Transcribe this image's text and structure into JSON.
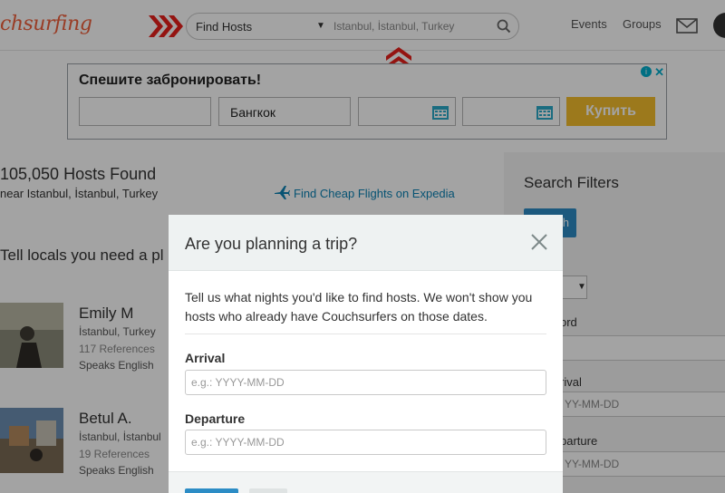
{
  "header": {
    "logo_text": "chsurfing",
    "search_type": "Find Hosts",
    "search_location": "Istanbul, İstanbul, Turkey",
    "nav_events": "Events",
    "nav_groups": "Groups"
  },
  "ad": {
    "title": "Спешите забронировать!",
    "destination": "Бангкок",
    "buy_label": "Купить",
    "info_glyph": "i",
    "close_glyph": "✕"
  },
  "results": {
    "hosts_found": "105,050 Hosts Found",
    "near_text": "near Istanbul, İstanbul, Turkey",
    "flights_link": "Find Cheap Flights on Expedia",
    "tell_locals": "Tell locals you need a pl"
  },
  "hosts": [
    {
      "name": "Emily M",
      "location": "İstanbul, Turkey",
      "references": "117 References",
      "languages": "Speaks English"
    },
    {
      "name": "Betul A.",
      "location": "İstanbul, İstanbul",
      "references": "19 References",
      "languages": "Speaks English"
    }
  ],
  "filters": {
    "title": "Search Filters",
    "button_label": "h",
    "keyword_label": "ord",
    "arrival_label": "rival",
    "arrival_placeholder": "YY-MM-DD",
    "departure_label": "parture",
    "departure_placeholder": "YY-MM-DD"
  },
  "modal": {
    "title": "Are you planning a trip?",
    "description": "Tell us what nights you'd like to find hosts. We won't show you hosts who already have Couchsurfers on those dates.",
    "arrival_label": "Arrival",
    "arrival_placeholder": "e.g.: YYYY-MM-DD",
    "departure_label": "Departure",
    "departure_placeholder": "e.g.: YYYY-MM-DD"
  },
  "colors": {
    "brand": "#f05f3b",
    "primary_button": "#2c8cc5",
    "annotation_red": "#e8201c",
    "link": "#0b82b5"
  }
}
